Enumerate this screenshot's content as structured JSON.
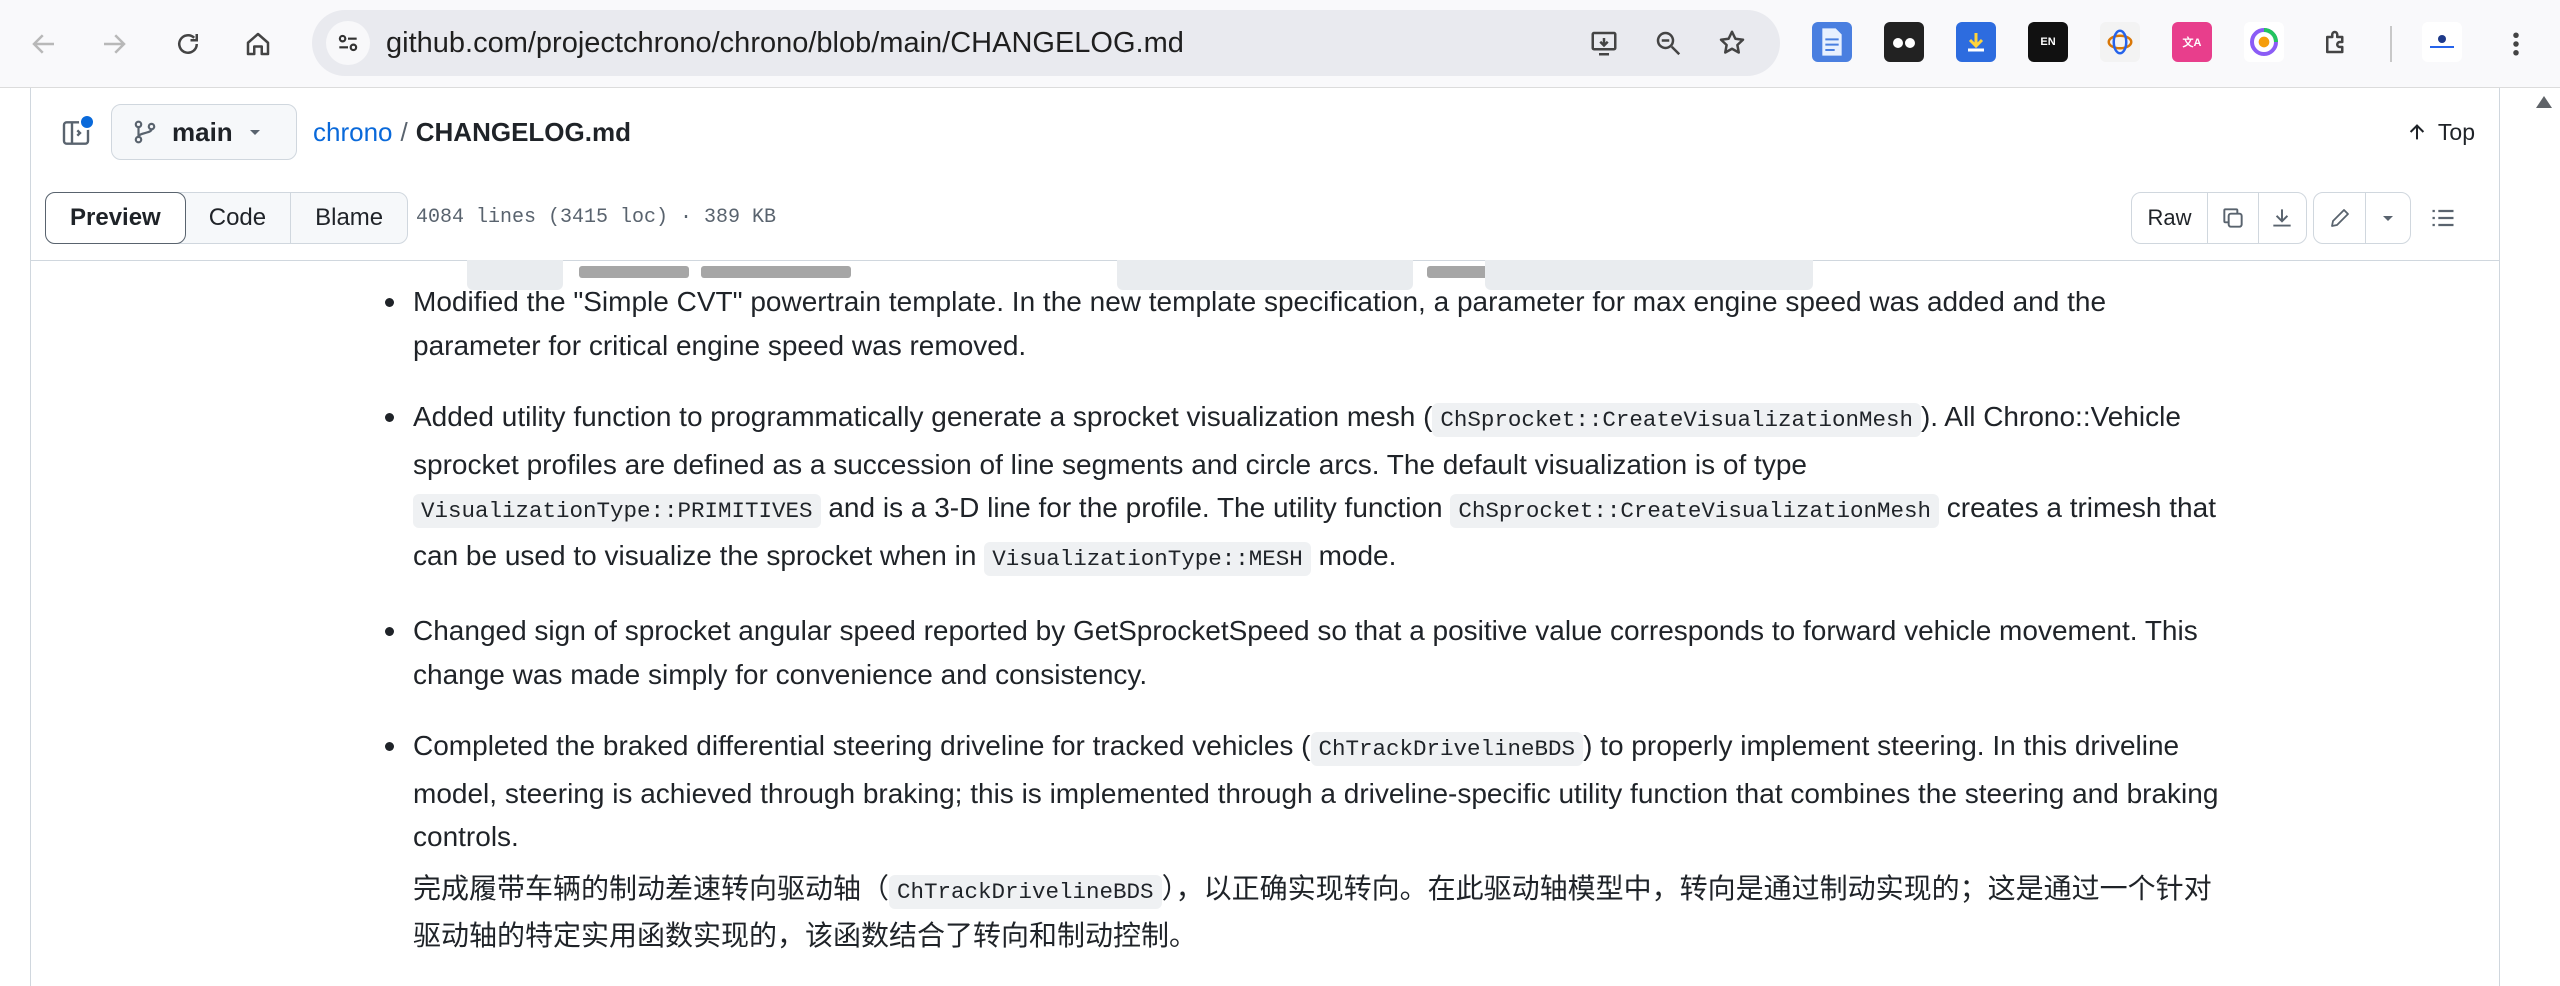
{
  "browser": {
    "url": "github.com/projectchrono/chrono/blob/main/CHANGELOG.md",
    "icons": [
      "back-icon",
      "forward-icon",
      "reload-icon",
      "home-icon",
      "site-info-icon",
      "install-app-icon",
      "zoom-icon",
      "bookmark-star-icon",
      "extensions-icon",
      "kebab-menu-icon"
    ],
    "extensions": [
      "docs-extension",
      "glasses-extension",
      "download-extension",
      "en-extension",
      "ai-extension",
      "translate-extension",
      "color-extension",
      "puzzle-extension",
      "profile-avatar"
    ]
  },
  "header": {
    "branch": "main",
    "repo": "chrono",
    "separator": "/",
    "file": "CHANGELOG.md",
    "top_label": "Top"
  },
  "toolbar": {
    "tabs": [
      "Preview",
      "Code",
      "Blame"
    ],
    "active_tab": "Preview",
    "file_info": "4084 lines (3415 loc) · 389 KB",
    "raw_label": "Raw"
  },
  "content": {
    "items": [
      {
        "text1": "Modified the \"Simple CVT\" powertrain template. In the new template specification, a parameter for max engine speed was added and the parameter for critical engine speed was removed."
      },
      {
        "t1": "Added utility function to programmatically generate a sprocket visualization mesh (",
        "c1": "ChSprocket::CreateVisualizationMesh",
        "t2": "). All Chrono::Vehicle sprocket profiles are defined as a succession of line segments and circle arcs. The default visualization is of type ",
        "c2": "VisualizationType::PRIMITIVES",
        "t3": " and is a 3-D line for the profile. The utility function ",
        "c3": "ChSprocket::CreateVisualizationMesh",
        "t4": " creates a trimesh that can be used to visualize the sprocket when in ",
        "c4": "VisualizationType::MESH",
        "t5": " mode."
      },
      {
        "text1": "Changed sign of sprocket angular speed reported by GetSprocketSpeed so that a positive value corresponds to forward vehicle movement. This change was made simply for convenience and consistency."
      },
      {
        "t1": "Completed the braked differential steering driveline for tracked vehicles (",
        "c1": "ChTrackDrivelineBDS",
        "t2": ") to properly implement steering. In this driveline model, steering is achieved through braking; this is implemented through a driveline-specific utility function that combines the steering and braking controls."
      }
    ],
    "translation": {
      "t1": "完成履带车辆的制动差速转向驱动轴（",
      "c1": "ChTrackDrivelineBDS",
      "t2": "），以正确实现转向。在此驱动轴模型中，转向是通过制动实现的；这是通过一个针对驱动轴的特定实用函数实现的，该函数结合了转向和制动控制。"
    }
  },
  "colors": {
    "link": "#0969da",
    "border": "#d0d7de",
    "muted": "#59636e",
    "code_bg": "#eff1f3"
  }
}
